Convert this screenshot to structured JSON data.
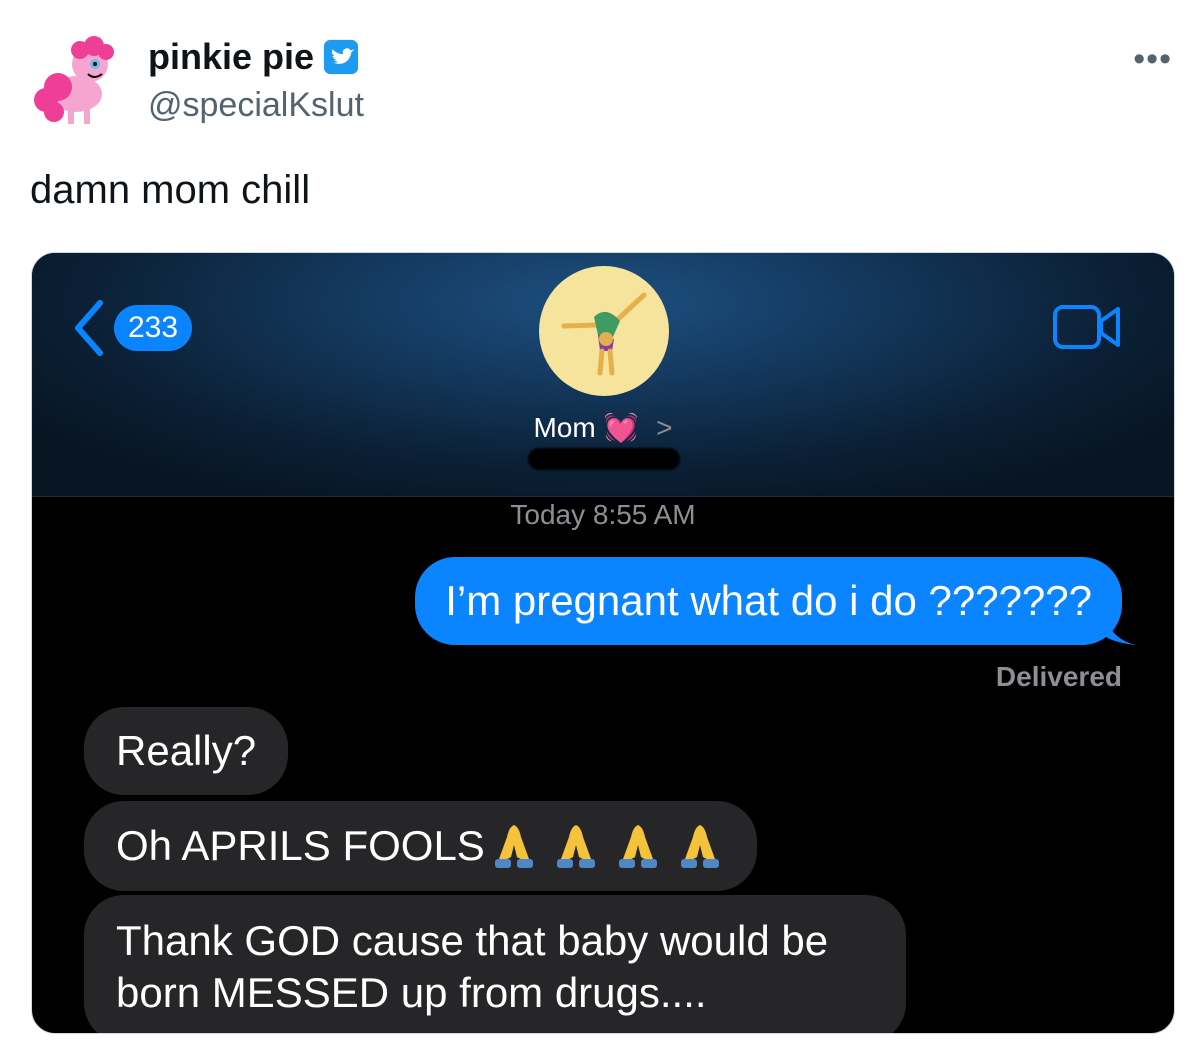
{
  "tweet": {
    "display_name": "pinkie pie",
    "handle": "@specialKslut",
    "text": "damn mom chill",
    "more_icon": "ellipsis-icon"
  },
  "screenshot": {
    "back_count": "233",
    "contact_name": "Mom",
    "contact_emoji": "💓",
    "timestamp": "Today 8:55 AM",
    "messages_sent": [
      {
        "text": "I’m pregnant what do i do ???????",
        "status": "Delivered"
      }
    ],
    "messages_received": [
      {
        "text": "Really?"
      },
      {
        "text": "Oh APRILS FOOLS",
        "emoji_count": 4
      },
      {
        "text": "Thank GOD cause that baby would be born MESSED up from drugs...."
      }
    ],
    "colors": {
      "imessage_blue": "#0a84ff",
      "received_bubble": "#262628",
      "twitter_blue": "#1d9bf0"
    }
  }
}
